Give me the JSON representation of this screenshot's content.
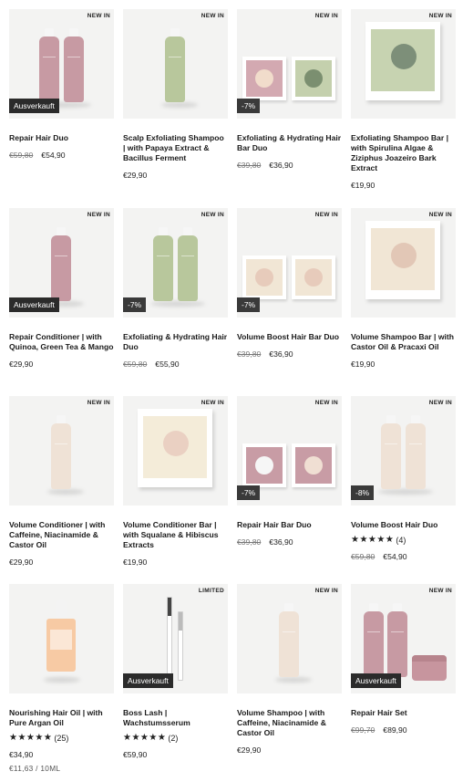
{
  "products": [
    {
      "name": "Repair Hair Duo",
      "badge": "NEW IN",
      "status": "Ausverkauft",
      "discount": "",
      "old_price": "€59,80",
      "price": "€54,90",
      "stars": "",
      "rating_count": "",
      "unit_price": "",
      "art": "duo-pink"
    },
    {
      "name": "Scalp Exfoliating Shampoo | with Papaya Extract & Bacillus Ferment",
      "badge": "NEW IN",
      "status": "",
      "discount": "",
      "old_price": "",
      "price": "€29,90",
      "stars": "",
      "rating_count": "",
      "unit_price": "",
      "art": "single-green"
    },
    {
      "name": "Exfoliating & Hydrating Hair Bar Duo",
      "badge": "NEW IN",
      "status": "",
      "discount": "-7%",
      "old_price": "€39,80",
      "price": "€36,90",
      "stars": "",
      "rating_count": "",
      "unit_price": "",
      "art": "bars-pink-green"
    },
    {
      "name": "Exfoliating Shampoo Bar | with Spirulina Algae & Ziziphus Joazeiro Bark Extract",
      "badge": "NEW IN",
      "status": "",
      "discount": "",
      "old_price": "",
      "price": "€19,90",
      "stars": "",
      "rating_count": "",
      "unit_price": "",
      "art": "box-green"
    },
    {
      "name": "Repair Conditioner | with Quinoa, Green Tea & Mango",
      "badge": "NEW IN",
      "status": "Ausverkauft",
      "discount": "",
      "old_price": "",
      "price": "€29,90",
      "stars": "",
      "rating_count": "",
      "unit_price": "",
      "art": "single-pink"
    },
    {
      "name": "Exfoliating & Hydrating Hair Duo",
      "badge": "NEW IN",
      "status": "",
      "discount": "-7%",
      "old_price": "€59,80",
      "price": "€55,90",
      "stars": "",
      "rating_count": "",
      "unit_price": "",
      "art": "duo-green"
    },
    {
      "name": "Volume Boost Hair Bar Duo",
      "badge": "NEW IN",
      "status": "",
      "discount": "-7%",
      "old_price": "€39,80",
      "price": "€36,90",
      "stars": "",
      "rating_count": "",
      "unit_price": "",
      "art": "bars-cream"
    },
    {
      "name": "Volume Shampoo Bar | with Castor Oil & Pracaxi Oil",
      "badge": "NEW IN",
      "status": "",
      "discount": "",
      "old_price": "",
      "price": "€19,90",
      "stars": "",
      "rating_count": "",
      "unit_price": "",
      "art": "box-cream"
    },
    {
      "name": "Volume Conditioner | with Caffeine, Niacinamide & Castor Oil",
      "badge": "NEW IN",
      "status": "",
      "discount": "",
      "old_price": "",
      "price": "€29,90",
      "stars": "",
      "rating_count": "",
      "unit_price": "",
      "art": "single-cream"
    },
    {
      "name": "Volume Conditioner Bar | with Squalane & Hibiscus Extracts",
      "badge": "NEW IN",
      "status": "",
      "discount": "",
      "old_price": "",
      "price": "€19,90",
      "stars": "",
      "rating_count": "",
      "unit_price": "",
      "art": "box-cream2"
    },
    {
      "name": "Repair Hair Bar Duo",
      "badge": "NEW IN",
      "status": "",
      "discount": "-7%",
      "old_price": "€39,80",
      "price": "€36,90",
      "stars": "",
      "rating_count": "",
      "unit_price": "",
      "art": "bars-pink"
    },
    {
      "name": "Volume Boost Hair Duo",
      "badge": "NEW IN",
      "status": "",
      "discount": "-8%",
      "old_price": "€59,80",
      "price": "€54,90",
      "stars": "★★★★★",
      "rating_count": "(4)",
      "unit_price": "",
      "art": "duo-cream"
    },
    {
      "name": "Nourishing Hair Oil | with Pure Argan Oil",
      "badge": "",
      "status": "",
      "discount": "",
      "old_price": "",
      "price": "€34,90",
      "stars": "★★★★★",
      "rating_count": "(25)",
      "unit_price": "€11,63 / 10ML",
      "art": "dropper"
    },
    {
      "name": "Boss Lash | Wachstumsserum",
      "badge": "LIMITED",
      "status": "Ausverkauft",
      "discount": "",
      "old_price": "",
      "price": "€59,90",
      "stars": "★★★★★",
      "rating_count": "(2)",
      "unit_price": "",
      "art": "pens"
    },
    {
      "name": "Volume Shampoo | with Caffeine, Niacinamide & Castor Oil",
      "badge": "NEW IN",
      "status": "",
      "discount": "",
      "old_price": "",
      "price": "€29,90",
      "stars": "",
      "rating_count": "",
      "unit_price": "",
      "art": "single-cream2"
    },
    {
      "name": "Repair Hair Set",
      "badge": "NEW IN",
      "status": "Ausverkauft",
      "discount": "",
      "old_price": "€99,70",
      "price": "€89,90",
      "stars": "",
      "rating_count": "",
      "unit_price": "",
      "art": "set-pink"
    }
  ],
  "colors": {
    "pink": "#c79aa3",
    "green": "#b8c79c",
    "cream": "#efe2d6",
    "badge_dark": "#2b2b2b"
  }
}
